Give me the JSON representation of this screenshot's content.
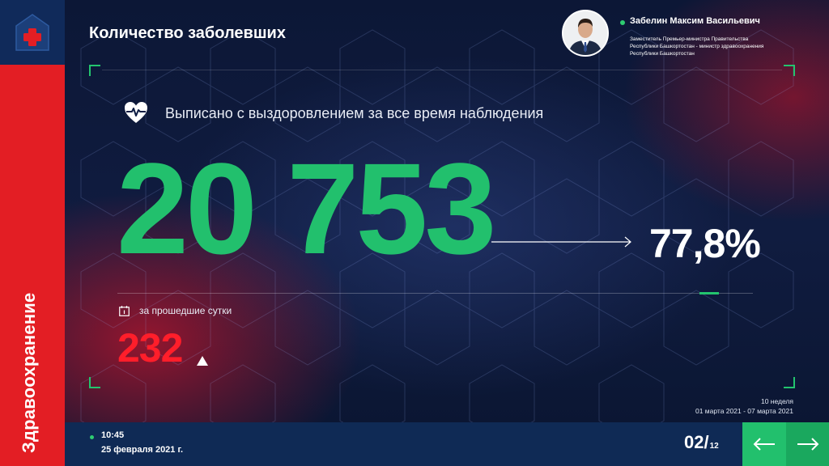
{
  "sidebar": {
    "label": "Здравоохранение",
    "logo_icon": "medical-cross-icon"
  },
  "header": {
    "title": "Количество заболевших",
    "person": {
      "name": "Забелин Максим Васильевич",
      "role_line1": "Заместитель Премьер-министра Правительства",
      "role_line2": "Республики Башкортостан - министр здравоохранения",
      "role_line3": "Республики Башкортостан"
    }
  },
  "main": {
    "subtitle": "Выписано с выздоровлением за все время наблюдения",
    "total_value": "20 753",
    "percent": "77,8%",
    "daily_label": "за прошедшие сутки",
    "daily_value": "232",
    "daily_trend": "up-arrow-icon",
    "week": "10 неделя",
    "week_range": "01 марта 2021 - 07 марта 2021"
  },
  "footer": {
    "time": "10:45",
    "date": "25 февраля 2021 г.",
    "page_current": "02/",
    "page_total": "12"
  },
  "colors": {
    "accent_green": "#22c06d",
    "accent_red": "#e31e24",
    "value_red": "#ff1e2a",
    "navy": "#0f2a55"
  }
}
